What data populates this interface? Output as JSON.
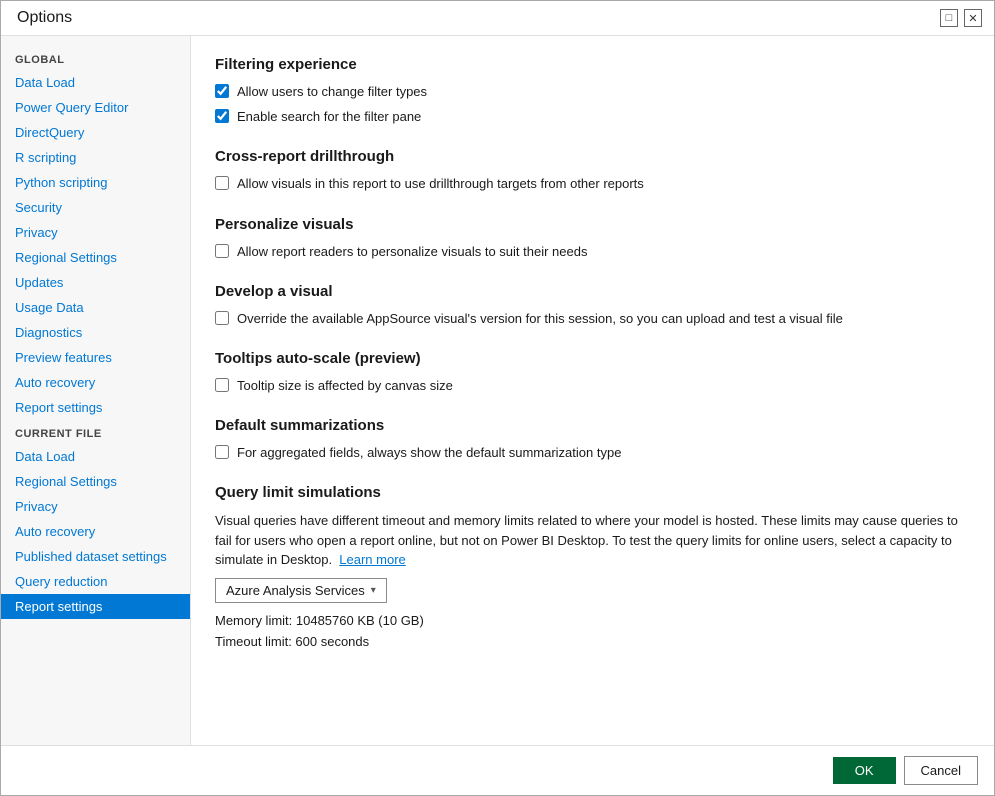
{
  "dialog": {
    "title": "Options",
    "window_controls": {
      "minimize": "□",
      "close": "✕"
    }
  },
  "sidebar": {
    "global_label": "GLOBAL",
    "global_items": [
      {
        "label": "Data Load",
        "active": false
      },
      {
        "label": "Power Query Editor",
        "active": false
      },
      {
        "label": "DirectQuery",
        "active": false
      },
      {
        "label": "R scripting",
        "active": false
      },
      {
        "label": "Python scripting",
        "active": false
      },
      {
        "label": "Security",
        "active": false
      },
      {
        "label": "Privacy",
        "active": false
      },
      {
        "label": "Regional Settings",
        "active": false
      },
      {
        "label": "Updates",
        "active": false
      },
      {
        "label": "Usage Data",
        "active": false
      },
      {
        "label": "Diagnostics",
        "active": false
      },
      {
        "label": "Preview features",
        "active": false
      },
      {
        "label": "Auto recovery",
        "active": false
      },
      {
        "label": "Report settings",
        "active": false
      }
    ],
    "current_file_label": "CURRENT FILE",
    "current_file_items": [
      {
        "label": "Data Load",
        "active": false
      },
      {
        "label": "Regional Settings",
        "active": false
      },
      {
        "label": "Privacy",
        "active": false
      },
      {
        "label": "Auto recovery",
        "active": false
      },
      {
        "label": "Published dataset settings",
        "active": false
      },
      {
        "label": "Query reduction",
        "active": false
      },
      {
        "label": "Report settings",
        "active": true
      }
    ]
  },
  "main": {
    "sections": [
      {
        "id": "filtering",
        "title": "Filtering experience",
        "checkboxes": [
          {
            "label": "Allow users to change filter types",
            "checked": true
          },
          {
            "label": "Enable search for the filter pane",
            "checked": true
          }
        ]
      },
      {
        "id": "cross-report",
        "title": "Cross-report drillthrough",
        "checkboxes": [
          {
            "label": "Allow visuals in this report to use drillthrough targets from other reports",
            "checked": false
          }
        ]
      },
      {
        "id": "personalize",
        "title": "Personalize visuals",
        "checkboxes": [
          {
            "label": "Allow report readers to personalize visuals to suit their needs",
            "checked": false
          }
        ]
      },
      {
        "id": "develop",
        "title": "Develop a visual",
        "checkboxes": [
          {
            "label": "Override the available AppSource visual's version for this session, so you can upload and test a visual file",
            "checked": false
          }
        ]
      },
      {
        "id": "tooltips",
        "title": "Tooltips auto-scale (preview)",
        "checkboxes": [
          {
            "label": "Tooltip size is affected by canvas size",
            "checked": false
          }
        ]
      },
      {
        "id": "default-sum",
        "title": "Default summarizations",
        "checkboxes": [
          {
            "label": "For aggregated fields, always show the default summarization type",
            "checked": false
          }
        ]
      }
    ],
    "query_limit": {
      "title": "Query limit simulations",
      "description": "Visual queries have different timeout and memory limits related to where your model is hosted. These limits may cause queries to fail for users who open a report online, but not on Power BI Desktop. To test the query limits for online users, select a capacity to simulate in Desktop.",
      "learn_more": "Learn more",
      "dropdown_label": "Azure Analysis Services",
      "memory_limit": "Memory limit: 10485760 KB (10 GB)",
      "timeout_limit": "Timeout limit: 600 seconds"
    }
  },
  "footer": {
    "ok_label": "OK",
    "cancel_label": "Cancel"
  }
}
